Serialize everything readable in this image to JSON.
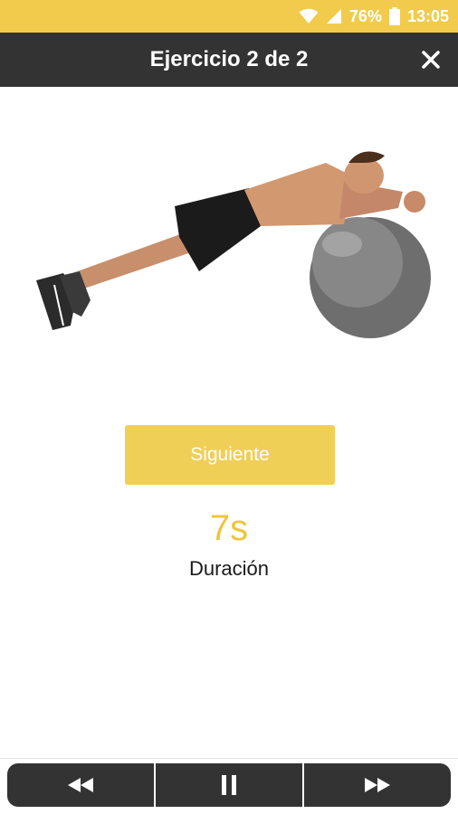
{
  "status_bar": {
    "battery_percent": "76%",
    "time": "13:05",
    "icons": [
      "wifi-icon",
      "cell-signal-icon",
      "battery-icon"
    ],
    "background_color": "#f2cb4c"
  },
  "header": {
    "title": "Ejercicio 2 de 2",
    "close_icon": "close-icon",
    "background_color": "#333333"
  },
  "exercise": {
    "image": "man-plank-on-stability-ball"
  },
  "next_button": {
    "label": "Siguiente",
    "color": "#f0cf56"
  },
  "timer": {
    "value": "7s",
    "label": "Duración",
    "value_color": "#f0c43c"
  },
  "controls": {
    "icons": [
      "rewind-icon",
      "pause-icon",
      "fast-forward-icon"
    ]
  }
}
